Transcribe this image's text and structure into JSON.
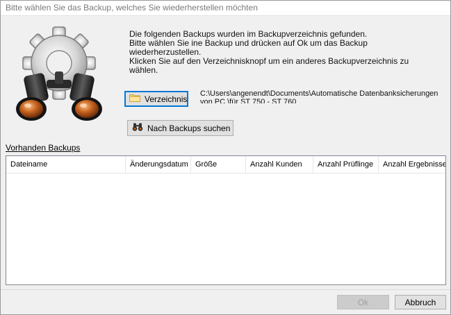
{
  "window": {
    "title": "Bitte wählen Sie das Backup, welches Sie wiederherstellen möchten"
  },
  "intro": {
    "line1": "Die folgenden Backups wurden im Backupverzeichnis gefunden.",
    "line2": "Bitte wählen Sie ine Backup und drücken auf Ok um das Backup wiederherzustellen.",
    "line3": "Klicken Sie auf den Verzeichnisknopf um ein anderes Backupverzeichnis zu wählen."
  },
  "hero_icon": "gear-binoculars-icon",
  "directory": {
    "button_label": "Verzeichnis",
    "button_icon": "folder-icon",
    "path": "C:\\Users\\angenendt\\Documents\\Automatische Datenbanksicherungen von PC \\für ST 750 - ST 760"
  },
  "search": {
    "button_label": "Nach Backups suchen",
    "button_icon": "binoculars-icon"
  },
  "backups": {
    "section_label": "Vorhanden Backups",
    "columns": [
      "Dateiname",
      "Änderungsdatum",
      "Größe",
      "Anzahl Kunden",
      "Anzahl Prüflinge",
      "Anzahl Ergebnisse"
    ],
    "rows": []
  },
  "footer": {
    "ok_label": "Ok",
    "cancel_label": "Abbruch"
  }
}
